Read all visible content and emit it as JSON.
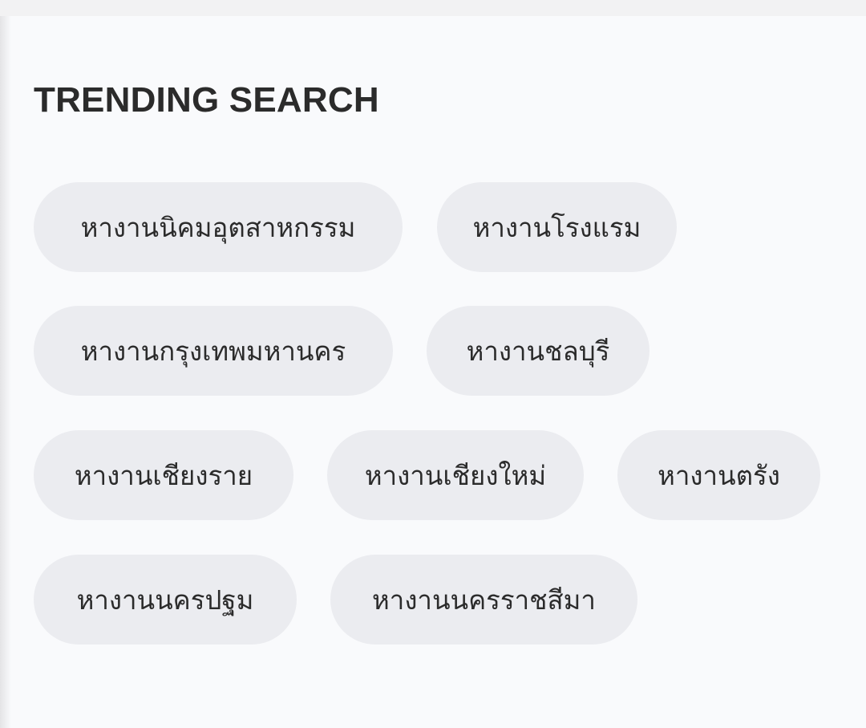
{
  "section": {
    "title": "TRENDING SEARCH"
  },
  "chips": [
    "หางานนิคมอุตสาหกรรม",
    "หางานโรงแรม",
    "หางานกรุงเทพมหานคร",
    "หางานชลบุรี",
    "หางานเชียงราย",
    "หางานเชียงใหม่",
    "หางานตรัง",
    "หางานนครปฐม",
    "หางานนครราชสีมา"
  ]
}
